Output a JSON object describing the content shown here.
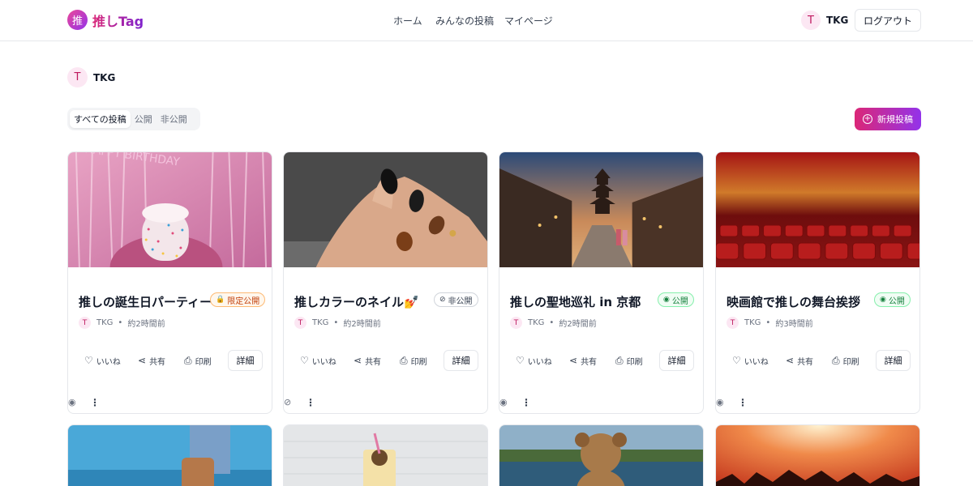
{
  "header": {
    "logo_mark": "推",
    "logo_text": "推しTag",
    "nav": [
      "ホーム",
      "みんなの投稿",
      "マイページ"
    ],
    "user_initial": "T",
    "user_name": "TKG",
    "logout_label": "ログアウト"
  },
  "profile": {
    "initial": "T",
    "name": "TKG"
  },
  "filters": {
    "tabs": [
      "すべての投稿",
      "公開",
      "非公開"
    ],
    "active": "すべての投稿"
  },
  "new_post_label": "新規投稿",
  "cards": [
    {
      "title": "推しの誕生日パーティー",
      "badge": {
        "label": "限定公開",
        "icon": "lock-icon",
        "kind": "limited"
      },
      "author_initial": "T",
      "author": "TKG",
      "time": "約2時間前",
      "image_kind": "birthday-cake",
      "footer_icon": "eye-icon",
      "image_text": "HAPPY BIRTHDAY"
    },
    {
      "title": "推しカラーのネイル💅",
      "badge": {
        "label": "非公開",
        "icon": "eye-off-icon",
        "kind": "private"
      },
      "author_initial": "T",
      "author": "TKG",
      "time": "約2時間前",
      "image_kind": "nails",
      "footer_icon": "eye-off-icon"
    },
    {
      "title": "推しの聖地巡礼 in 京都",
      "badge": {
        "label": "公開",
        "icon": "eye-icon",
        "kind": "public"
      },
      "author_initial": "T",
      "author": "TKG",
      "time": "約2時間前",
      "image_kind": "kyoto-street",
      "footer_icon": "eye-icon"
    },
    {
      "title": "映画館で推しの舞台挨拶",
      "badge": {
        "label": "公開",
        "icon": "eye-icon",
        "kind": "public"
      },
      "author_initial": "T",
      "author": "TKG",
      "time": "約3時間前",
      "image_kind": "theater-seats",
      "footer_icon": "eye-icon"
    }
  ],
  "card_actions": {
    "like": "いいね",
    "share": "共有",
    "print": "印刷",
    "detail": "詳細"
  },
  "icons": {
    "like": "heart-icon",
    "share": "share-icon",
    "print": "printer-icon",
    "more": "more-vertical-icon"
  },
  "colors": {
    "brand_pink": "#db2777",
    "brand_purple": "#9333ea"
  }
}
